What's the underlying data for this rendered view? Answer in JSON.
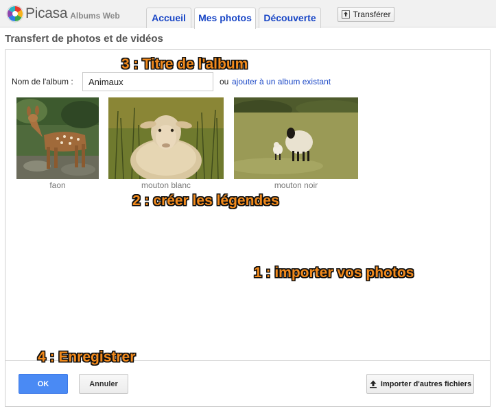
{
  "header": {
    "logo_text": "Picasa",
    "logo_sub": "Albums Web",
    "tabs": [
      {
        "label": "Accueil",
        "active": false
      },
      {
        "label": "Mes photos",
        "active": true
      },
      {
        "label": "Découverte",
        "active": false
      }
    ],
    "upload_label": "Transférer",
    "upload_icon": "upload-icon"
  },
  "page": {
    "title": "Transfert de photos et de vidéos"
  },
  "album": {
    "label": "Nom de l'album :",
    "value": "Animaux",
    "or_text": "ou",
    "existing_link": "ajouter à un album existant"
  },
  "photos": [
    {
      "caption": "faon",
      "subject": "fawn"
    },
    {
      "caption": "mouton blanc",
      "subject": "white-sheep"
    },
    {
      "caption": "mouton noir",
      "subject": "black-faced-sheep-with-lamb"
    }
  ],
  "annotations": {
    "a1": "1 : importer vos photos",
    "a2": "2 : créer les légendes",
    "a3": "3 : Titre de l'album",
    "a4": "4 : Enregistrer"
  },
  "footer": {
    "ok_label": "OK",
    "cancel_label": "Annuler",
    "import_label": "Importer d'autres fichiers",
    "import_icon": "upload-icon"
  },
  "colors": {
    "link": "#1a47c6",
    "primary_button": "#4a8af4",
    "annotation": "#f28a1c"
  }
}
